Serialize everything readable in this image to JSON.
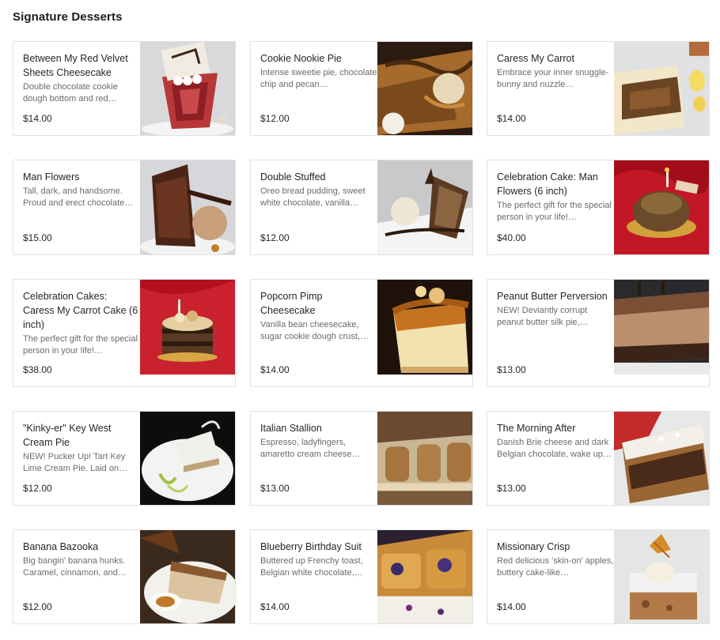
{
  "section": {
    "title": "Signature Desserts"
  },
  "items": [
    {
      "name": "Between My Red Velvet Sheets Cheesecake",
      "desc": "Double chocolate cookie dough bottom and red…",
      "price": "$14.00",
      "photo": "red-velvet-cheesecake"
    },
    {
      "name": "Cookie Nookie Pie",
      "desc": "Intense sweetie pie, chocolate chip and pecan…",
      "price": "$12.00",
      "photo": "cookie-pie"
    },
    {
      "name": "Caress My Carrot",
      "desc": "Embrace your inner snuggle-bunny and nuzzle…",
      "price": "$14.00",
      "photo": "carrot-cake"
    },
    {
      "name": "Man Flowers",
      "desc": "Tall, dark, and handsome. Proud and erect chocolate…",
      "price": "$15.00",
      "photo": "chocolate-cake"
    },
    {
      "name": "Double Stuffed",
      "desc": "Oreo bread pudding, sweet white chocolate, vanilla…",
      "price": "$12.00",
      "photo": "bread-pudding"
    },
    {
      "name": "Celebration Cake: Man Flowers (6 inch)",
      "desc": "The perfect gift for the special person in your life!…",
      "price": "$40.00",
      "photo": "celebration-chocolate"
    },
    {
      "name": "Celebration Cakes: Caress My Carrot Cake (6 inch)",
      "desc": "The perfect gift for the special person in your life!…",
      "price": "$38.00",
      "photo": "celebration-carrot"
    },
    {
      "name": "Popcorn Pimp Cheesecake",
      "desc": "Vanilla bean cheesecake, sugar cookie dough crust,…",
      "price": "$14.00",
      "photo": "popcorn-cheesecake"
    },
    {
      "name": "Peanut Butter Perversion",
      "desc": "NEW! Deviantly corrupt peanut butter silk pie,…",
      "price": "$13.00",
      "photo": "peanut-butter-pie"
    },
    {
      "name": "\"Kinky-er\" Key West Cream Pie",
      "desc": "NEW! Pucker Up! Tart Key Lime Cream Pie. Laid on…",
      "price": "$12.00",
      "photo": "key-lime-pie"
    },
    {
      "name": "Italian Stallion",
      "desc": "Espresso, ladyfingers, amaretto cream cheese…",
      "price": "$13.00",
      "photo": "tiramisu"
    },
    {
      "name": "The Morning After",
      "desc": "Danish Brie cheese and dark Belgian chocolate, wake up…",
      "price": "$13.00",
      "photo": "brie-toast"
    },
    {
      "name": "Banana Bazooka",
      "desc": "Big bangin' banana hunks. Caramel, cinnamon, and…",
      "price": "$12.00",
      "photo": "banana-pie"
    },
    {
      "name": "Blueberry Birthday Suit",
      "desc": "Buttered up Frenchy toast, Belgian white chocolate,…",
      "price": "$14.00",
      "photo": "blueberry-toast"
    },
    {
      "name": "Missionary Crisp",
      "desc": "Red delicious 'skin-on' apples, buttery cake-like…",
      "price": "$14.00",
      "photo": "apple-crisp"
    }
  ]
}
